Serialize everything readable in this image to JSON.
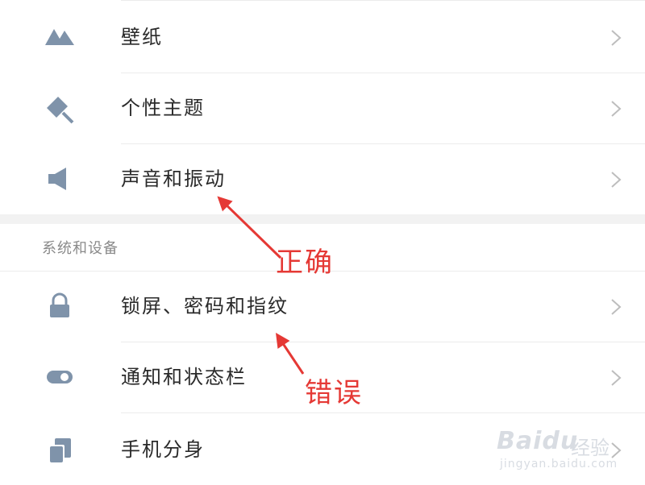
{
  "settings": {
    "items": [
      {
        "label": "壁纸",
        "icon": "mountain-icon"
      },
      {
        "label": "个性主题",
        "icon": "theme-brush-icon"
      },
      {
        "label": "声音和振动",
        "icon": "speaker-icon"
      }
    ],
    "section_system": {
      "header": "系统和设备",
      "items": [
        {
          "label": "锁屏、密码和指纹",
          "icon": "lock-icon"
        },
        {
          "label": "通知和状态栏",
          "icon": "toggle-icon"
        },
        {
          "label": "手机分身",
          "icon": "dual-phone-icon"
        }
      ]
    }
  },
  "annotations": {
    "correct": "正确",
    "wrong": "错误"
  },
  "watermark": {
    "logo": "Baidu",
    "cn": "经验",
    "url": "jingyan.baidu.com"
  },
  "colors": {
    "icon": "#7f93aa",
    "annotation": "#e53935",
    "chevron": "#bdbdbd"
  }
}
